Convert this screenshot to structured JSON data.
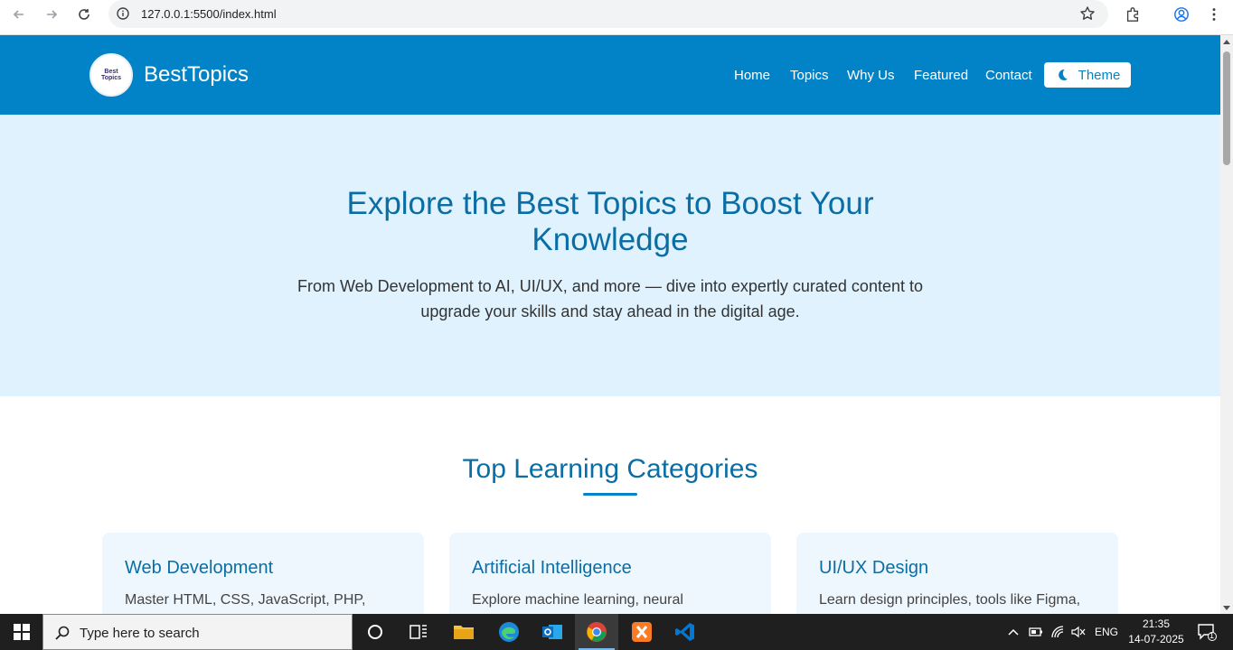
{
  "browser": {
    "url": "127.0.0.1:5500/index.html"
  },
  "site": {
    "logo_text_line1": "Best",
    "logo_text_line2": "Topics",
    "brand": "BestTopics",
    "nav": [
      "Home",
      "Topics",
      "Why Us",
      "Featured",
      "Contact"
    ],
    "theme_label": "Theme"
  },
  "hero": {
    "title": "Explore the Best Topics to Boost Your Knowledge",
    "subtitle": "From Web Development to AI, UI/UX, and more — dive into expertly curated content to upgrade your skills and stay ahead in the digital age."
  },
  "categories": {
    "title": "Top Learning Categories",
    "cards": [
      {
        "title": "Web Development",
        "desc": "Master HTML, CSS, JavaScript, PHP,"
      },
      {
        "title": "Artificial Intelligence",
        "desc": "Explore machine learning, neural"
      },
      {
        "title": "UI/UX Design",
        "desc": "Learn design principles, tools like Figma,"
      }
    ]
  },
  "taskbar": {
    "search_placeholder": "Type here to search",
    "language": "ENG",
    "time": "21:35",
    "date": "14-07-2025",
    "notification_count": "1"
  },
  "colors": {
    "header_blue": "#0383c7",
    "hero_bg": "#dff2fd",
    "heading_blue": "#0a6ea5"
  }
}
